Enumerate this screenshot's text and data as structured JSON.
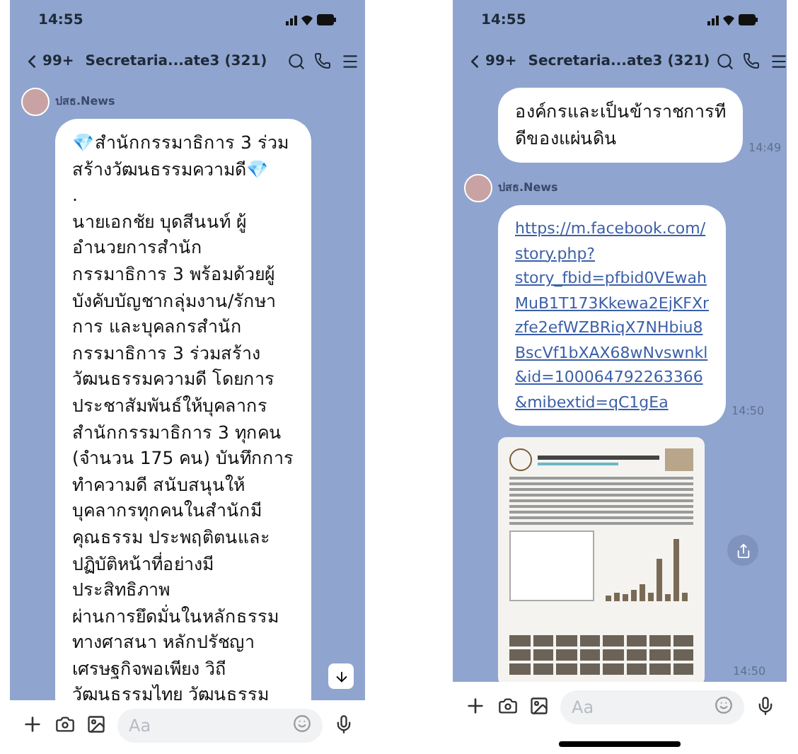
{
  "phones": [
    {
      "status": {
        "time": "14:55"
      },
      "header": {
        "back_count": "99+",
        "title": "Secretaria...ate3 (321)"
      },
      "scroll_down_button": true,
      "home_indicator": false,
      "messages": [
        {
          "kind": "text",
          "sender": "ปสธ.News",
          "lines": [
            "💎สำนักกรรมาธิการ 3 ร่วม",
            "สร้างวัฒนธรรมความดี💎",
            ".",
            "นายเอกชัย บุดสีนนท์ ผู้",
            "อำนวยการสำนัก",
            "กรรมาธิการ 3 พร้อมด้วยผู้",
            "บังคับบัญชากลุ่มงาน/รักษา",
            "การ และบุคลกรสำนัก",
            "กรรมาธิการ 3 ร่วมสร้าง",
            "วัฒนธรรมความดี โดยการ",
            "ประชาสัมพันธ์ให้บุคลากร",
            "สำนักกรรมาธิการ 3 ทุกคน",
            "(จำนวน 175 คน) บันทึกการ",
            "ทำความดี สนับสนุนให้",
            "บุคลากรทุกคนในสำนักมี",
            "คุณธรรม ประพฤติตนและ",
            "ปฏิบัติหน้าที่อย่างมี",
            "ประสิทธิภาพ",
            "ผ่านการยึดมั่นในหลักธรรม",
            "ทางศาสนา หลักปรัชญา",
            "เศรษฐกิจพอเพียง วิถี",
            "วัฒนธรรมไทย วัฒนธรรม"
          ]
        }
      ],
      "input": {
        "placeholder": "Aa"
      }
    },
    {
      "status": {
        "time": "14:55"
      },
      "header": {
        "back_count": "99+",
        "title": "Secretaria...ate3 (321)"
      },
      "scroll_down_button": false,
      "home_indicator": true,
      "messages": [
        {
          "kind": "text",
          "time": "14:49",
          "lines": [
            "องค์กรและเป็นข้าราชการที",
            "ดีของแผ่นดิน"
          ]
        },
        {
          "kind": "link",
          "sender": "ปสธ.News",
          "time": "14:50",
          "lines": [
            "https://m.facebook.com/",
            "story.php?",
            "story_fbid=pfbid0VEwah",
            "MuB1T173Kkewa2EjKFXr",
            "zfe2efWZBRiqX7NHbiu8",
            "BscVf1bXAX68wNvswnkl",
            "&id=100064792263366",
            "&mibextid=qC1gEa"
          ]
        },
        {
          "kind": "image",
          "time": "14:50"
        }
      ],
      "input": {
        "placeholder": "Aa"
      }
    }
  ]
}
